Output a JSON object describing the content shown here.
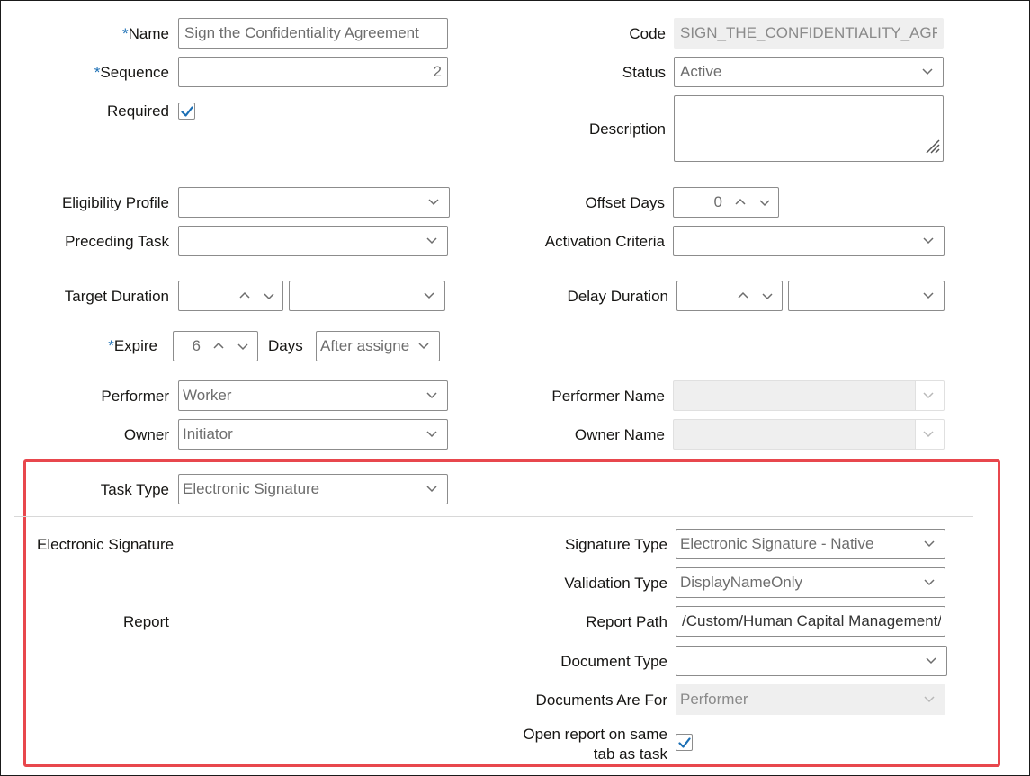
{
  "form": {
    "name": {
      "label": "Name",
      "value": "Sign the Confidentiality Agreement"
    },
    "sequence": {
      "label": "Sequence",
      "value": "2"
    },
    "required": {
      "label": "Required",
      "checked": true
    },
    "code": {
      "label": "Code",
      "value": "SIGN_THE_CONFIDENTIALITY_AGREEM"
    },
    "status": {
      "label": "Status",
      "value": "Active"
    },
    "description": {
      "label": "Description",
      "value": ""
    },
    "eligibility_profile": {
      "label": "Eligibility Profile",
      "value": ""
    },
    "offset_days": {
      "label": "Offset Days",
      "value": "0"
    },
    "preceding_task": {
      "label": "Preceding Task",
      "value": ""
    },
    "activation_criteria": {
      "label": "Activation Criteria",
      "value": ""
    },
    "target_duration": {
      "label": "Target Duration",
      "value": "",
      "unit": ""
    },
    "delay_duration": {
      "label": "Delay Duration",
      "value": "",
      "unit": ""
    },
    "expire": {
      "label": "Expire",
      "value": "6",
      "unit_label": "Days",
      "when": "After assigned"
    },
    "performer": {
      "label": "Performer",
      "value": "Worker"
    },
    "performer_name": {
      "label": "Performer Name",
      "value": ""
    },
    "owner": {
      "label": "Owner",
      "value": "Initiator"
    },
    "owner_name": {
      "label": "Owner Name",
      "value": ""
    },
    "task_type": {
      "label": "Task Type",
      "value": "Electronic Signature"
    }
  },
  "esign": {
    "section_label": "Electronic Signature",
    "report_label": "Report",
    "signature_type": {
      "label": "Signature Type",
      "value": "Electronic Signature - Native"
    },
    "validation_type": {
      "label": "Validation Type",
      "value": "DisplayNameOnly"
    },
    "report_path": {
      "label": "Report Path",
      "value": "/Custom/Human Capital Management/"
    },
    "document_type": {
      "label": "Document Type",
      "value": ""
    },
    "documents_are_for": {
      "label": "Documents Are For",
      "value": "Performer"
    },
    "open_report": {
      "label_line1": "Open report on same",
      "label_line2": "tab as task",
      "checked": true
    }
  },
  "required_marker": "*",
  "colors": {
    "required": "#1b6fb5",
    "highlight_border": "#e8474d",
    "checkbox": "#1b6fb5"
  }
}
